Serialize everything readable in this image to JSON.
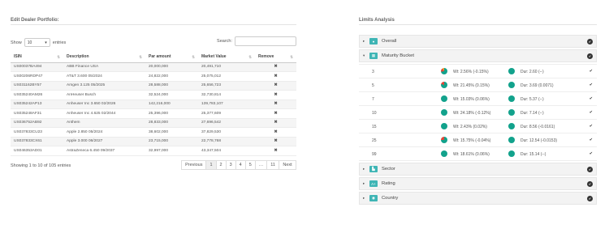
{
  "left": {
    "title": "Edit Dealer Portfolio:",
    "show_label": "Show",
    "show_value": "10",
    "entries_label": "entries",
    "search_label": "Search:",
    "columns": [
      "ISIN",
      "Description",
      "Par amount",
      "Market Value",
      "Remove"
    ],
    "rows": [
      [
        "US00037BA494",
        "ABB Finance USA",
        "20,000,000",
        "20,491,710",
        "✖"
      ],
      [
        "US00206RDP47",
        "AT&T 3.600 05/2024",
        "24,822,000",
        "25,075,012",
        "✖"
      ],
      [
        "US031162BY57",
        "Amgen 3.125 05/2025",
        "28,588,000",
        "25,656,723",
        "✖"
      ],
      [
        "US035240AM26",
        "AnHeuser Busch",
        "32,524,000",
        "32,730,814",
        "✖"
      ],
      [
        "US035242AP13",
        "Anheuser Inc 3.650 02/2026",
        "142,216,000",
        "139,783,107",
        "✖"
      ],
      [
        "US035248AF31",
        "Anheuser Inc 4.625 02/2044",
        "25,396,000",
        "25,377,609",
        "✖"
      ],
      [
        "US036752AB92",
        "Anthem",
        "28,833,000",
        "27,696,542",
        "✖"
      ],
      [
        "US037833CU23",
        "Apple 2.850 05/2024",
        "38,602,000",
        "37,829,530",
        "✖"
      ],
      [
        "US037833CX61",
        "Apple 3.000 06/2027",
        "23,715,000",
        "22,778,768",
        "✖"
      ],
      [
        "US046353AD01",
        "AstraZeneca 6.450 09/2037",
        "32,997,000",
        "43,347,504",
        "✖"
      ]
    ],
    "info": "Showing 1 to 10 of 105 entries",
    "pager": [
      "Previous",
      "1",
      "2",
      "3",
      "4",
      "5",
      "…",
      "11",
      "Next"
    ]
  },
  "right": {
    "title": "Limits Analysis",
    "overall": "Overall",
    "maturity": "Maturity Bucket",
    "buckets": [
      {
        "term": "3",
        "wt": "Wt: 2.56% (-0.15%)",
        "dur": "Dur: 2.60 (--)"
      },
      {
        "term": "5",
        "wt": "Wt: 21.45% (0.15%)",
        "dur": "Dur: 3.69 (0.0071)"
      },
      {
        "term": "7",
        "wt": "Wt: 15.03% (0.06%)",
        "dur": "Dur: 5.37 (--)"
      },
      {
        "term": "10",
        "wt": "Wt: 24.18% (-0.12%)",
        "dur": "Dur: 7.14 (--)"
      },
      {
        "term": "15",
        "wt": "Wt: 2.43% (0.02%)",
        "dur": "Dur: 8.56 (-0.0161)"
      },
      {
        "term": "25",
        "wt": "Wt: 15.75% (-0.04%)",
        "dur": "Dur: 12.54 (-0.0153)"
      },
      {
        "term": "99",
        "wt": "Wt: 18.61% (0.06%)",
        "dur": "Dur: 15.14 (--)"
      }
    ],
    "sector": "Sector",
    "rating": "Rating",
    "country": "Country"
  },
  "colors": {
    "accent_teal": "#3fb5b5",
    "remove_red": "#d9363e",
    "pie_green": "#12a28c",
    "pie_red": "#e0473a",
    "pie_orange": "#f39c2a"
  },
  "icons": {
    "expand": "caret-right-icon",
    "collapse": "caret-down-icon",
    "ok": "check-circle-icon",
    "remove": "x-icon"
  }
}
